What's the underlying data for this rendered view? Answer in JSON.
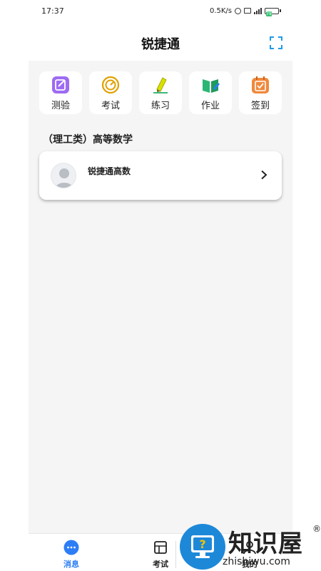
{
  "status_bar": {
    "time": "17:37",
    "network_speed": "0.5K/s",
    "battery_level": "79"
  },
  "header": {
    "title": "锐捷通",
    "fullscreen_icon": "fullscreen-icon"
  },
  "quick_actions": [
    {
      "label": "测验",
      "icon": "quiz-icon",
      "color": "#8b5cf6"
    },
    {
      "label": "考试",
      "icon": "exam-icon",
      "color": "#e0a100"
    },
    {
      "label": "练习",
      "icon": "practice-icon",
      "color": "#c9d400"
    },
    {
      "label": "作业",
      "icon": "homework-icon",
      "color": "#2bb673"
    },
    {
      "label": "签到",
      "icon": "checkin-icon",
      "color": "#f0893c"
    }
  ],
  "course_section": {
    "heading": "（理工类）高等数学",
    "card": {
      "name": "锐捷通高数",
      "avatar_icon": "avatar-icon",
      "chevron_icon": "chevron-right-icon"
    }
  },
  "tab_bar": {
    "tabs": [
      {
        "label": "消息",
        "icon": "chat-bubble-icon",
        "active": true
      },
      {
        "label": "考试",
        "icon": "exam-tab-icon",
        "active": false
      },
      {
        "label": "我的",
        "icon": "profile-icon",
        "active": false
      }
    ]
  },
  "watermark": {
    "text": "知识屋",
    "url": "zhishiwu.com",
    "reg": "®"
  },
  "colors": {
    "accent": "#2d7df6",
    "content_bg": "#f5f5f5"
  }
}
